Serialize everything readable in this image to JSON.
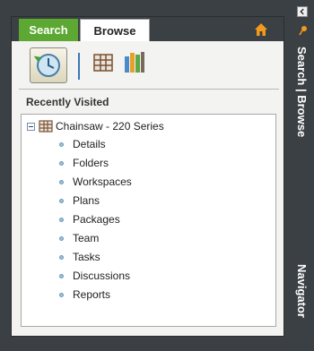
{
  "tabs": [
    {
      "label": "Search"
    },
    {
      "label": "Browse"
    }
  ],
  "section_title": "Recently Visited",
  "tree": {
    "root": "Chainsaw - 220 Series",
    "children": [
      "Details",
      "Folders",
      "Workspaces",
      "Plans",
      "Packages",
      "Team",
      "Tasks",
      "Discussions",
      "Reports"
    ]
  },
  "side_labels": {
    "search_browse": "Search | Browse",
    "navigator": "Navigator"
  },
  "colors": {
    "background": "#3b4044",
    "search_tab": "#5ca832",
    "accent_blue": "#3b78b5",
    "home_icon": "#f39a1e"
  }
}
